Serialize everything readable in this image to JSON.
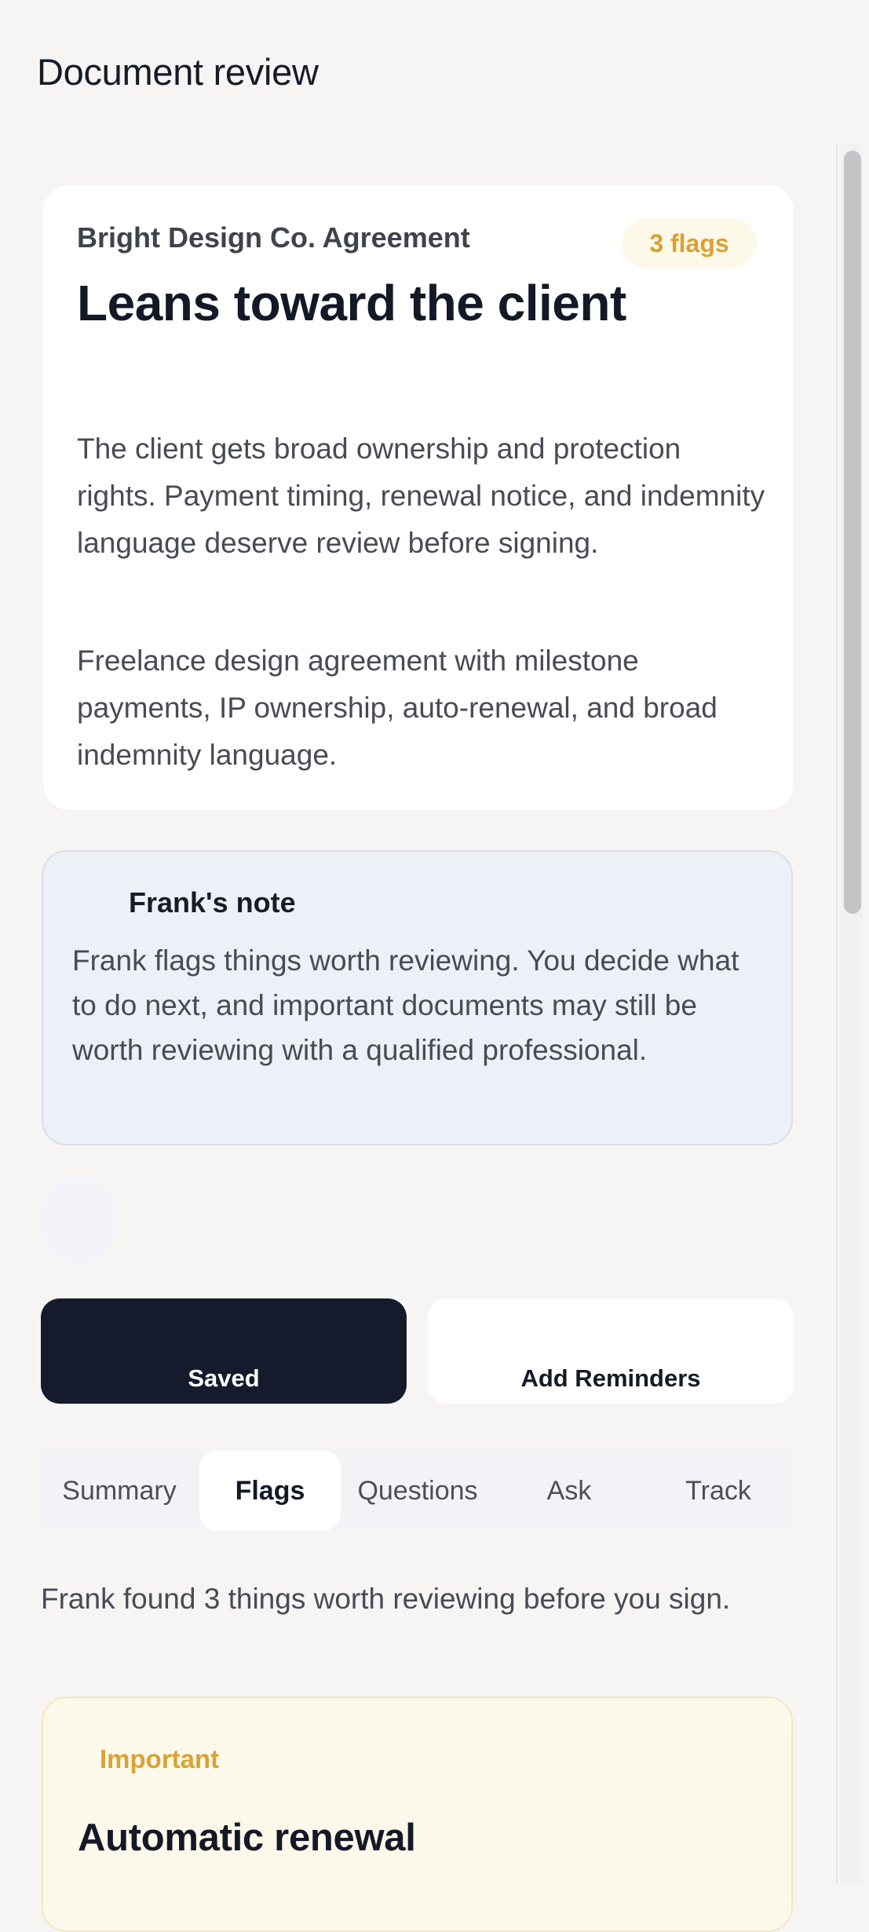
{
  "header": {
    "title": "Document review"
  },
  "summary": {
    "document_name": "Bright Design Co. Agreement",
    "flag_count_badge": "3 flags",
    "verdict": "Leans toward the client",
    "explanation": "The client gets broad ownership and protection rights. Payment timing, renewal notice, and indemnity language deserve review before signing.",
    "description": "Freelance design agreement with milestone payments, IP ownership, auto-renewal, and broad indemnity language."
  },
  "note": {
    "title": "Frank's note",
    "body": "Frank flags things worth reviewing. You decide what to do next, and important documents may still be worth reviewing with a qualified professional."
  },
  "actions": {
    "saved_label": "Saved",
    "reminders_label": "Add Reminders"
  },
  "tabs": [
    {
      "label": "Summary",
      "active": false
    },
    {
      "label": "Flags",
      "active": true
    },
    {
      "label": "Questions",
      "active": false
    },
    {
      "label": "Ask",
      "active": false
    },
    {
      "label": "Track",
      "active": false
    }
  ],
  "flags": {
    "intro": "Frank found 3 things worth reviewing before you sign.",
    "items": [
      {
        "severity": "Important",
        "title": "Automatic renewal"
      }
    ]
  },
  "colors": {
    "background": "#f6f5f4",
    "card": "#ffffff",
    "primary_dark": "#151b2c",
    "note_background": "#edf0f7",
    "warning_accent": "#d9a233",
    "warning_background": "#fdf9ea"
  }
}
